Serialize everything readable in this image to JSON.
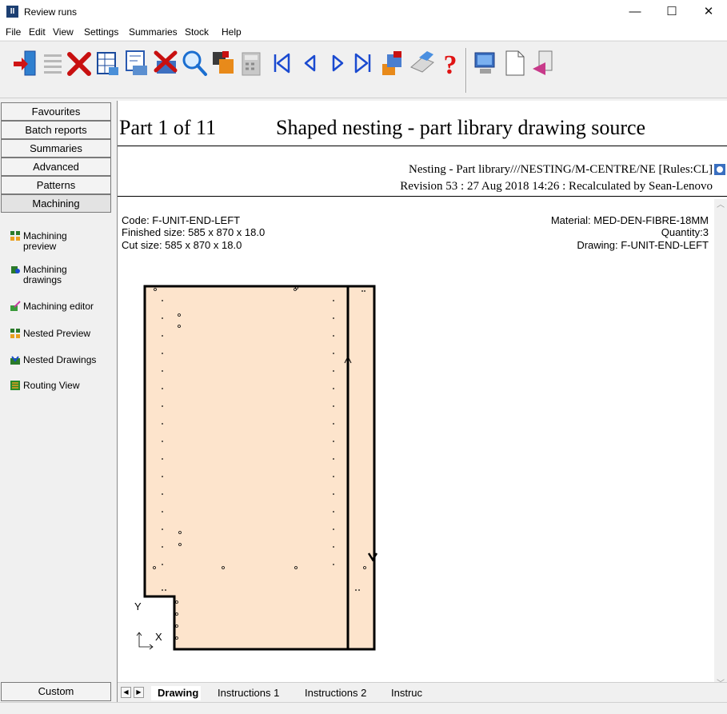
{
  "window": {
    "title": "Review runs",
    "minimize": "—",
    "maximize": "☐",
    "close": "✕"
  },
  "menu": [
    "File",
    "Edit",
    "View",
    "Settings",
    "Summaries",
    "Stock",
    "Help"
  ],
  "toolbar": {
    "buttons": [
      "open-icon",
      "list-icon",
      "delete-icon",
      "grid-report-icon",
      "layout-icon",
      "cancel-layout-icon",
      "search-icon",
      "parts-icon",
      "calculator-icon",
      "first-icon",
      "previous-icon",
      "next-icon",
      "last-icon",
      "stack-icon",
      "print-icon",
      "help-icon",
      "monitor-icon",
      "blank-page-icon",
      "export-icon"
    ]
  },
  "sidebar": {
    "nav": [
      "Favourites",
      "Batch reports",
      "Summaries",
      "Advanced",
      "Patterns",
      "Machining"
    ],
    "tools": [
      "Machining preview",
      "Machining drawings",
      "Machining editor",
      "Nested Preview",
      "Nested Drawings",
      "Routing View"
    ],
    "tool_lines": [
      [
        "Machining",
        "preview"
      ],
      [
        "Machining",
        "drawings"
      ],
      [
        "Machining editor"
      ],
      [
        "Nested Preview"
      ],
      [
        "Nested Drawings"
      ],
      [
        "Routing View"
      ]
    ],
    "custom": "Custom"
  },
  "report": {
    "part_label": "Part 1 of 11",
    "heading": "Shaped nesting - part library drawing source",
    "source": "Nesting - Part library///NESTING/M-CENTRE/NE [Rules:CL]",
    "revision": "Revision 53 : 27 Aug 2018 14:26 : Recalculated by Sean-Lenovo",
    "code": "Code: F-UNIT-END-LEFT",
    "finished": "Finished size: 585 x 870 x  18.0",
    "cut": "Cut size: 585 x 870 x  18.0",
    "material": "Material: MED-DEN-FIBRE-18MM",
    "quantity": "Quantity:3",
    "drawing": "Drawing: F-UNIT-END-LEFT",
    "axis_y": "Y",
    "axis_x": "X",
    "panel_color": "#fde4cc"
  },
  "tabs": [
    "Drawing",
    "Instructions 1",
    "Instructions 2",
    "Instruc"
  ],
  "colors": {
    "accent_red": "#d01414",
    "accent_blue": "#1a4a9c"
  }
}
